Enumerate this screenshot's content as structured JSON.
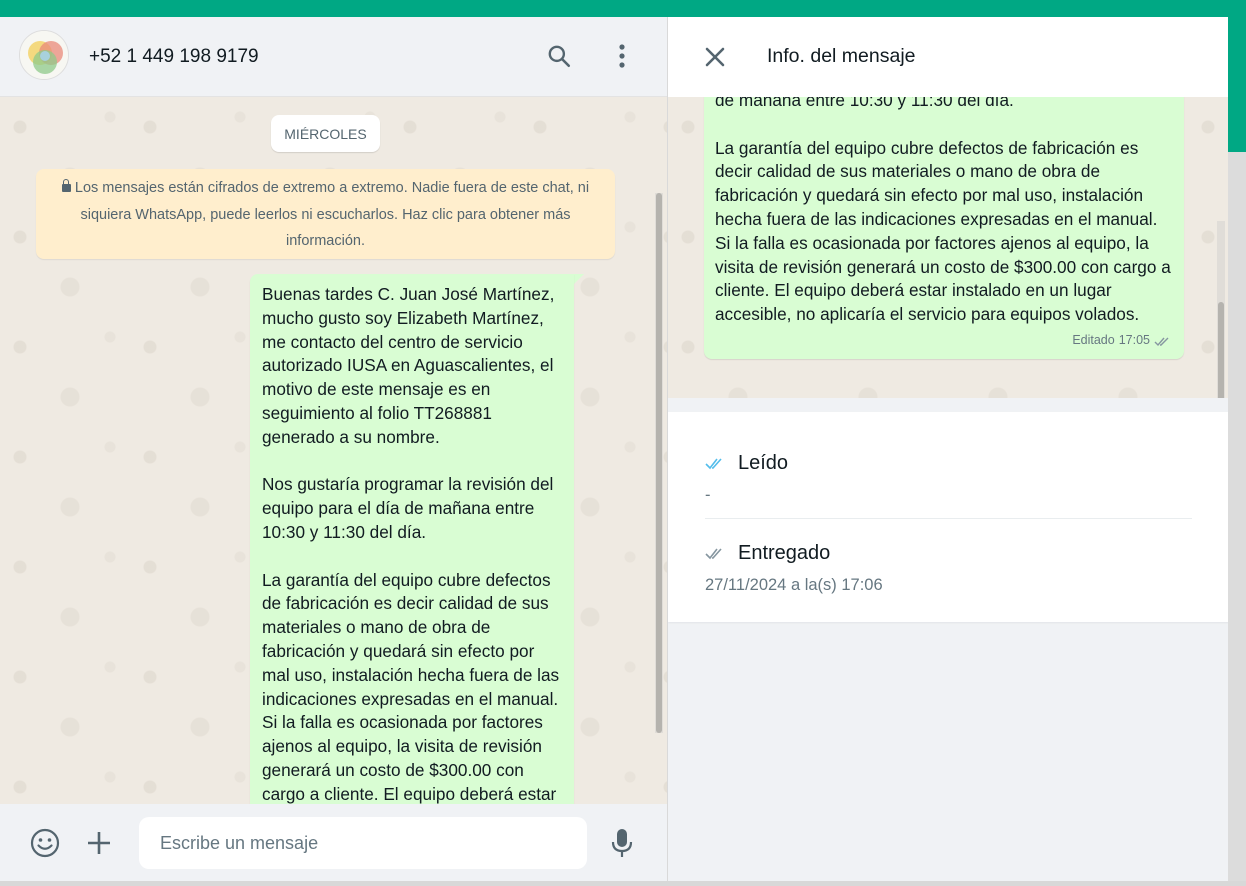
{
  "chat": {
    "contact_name": "+52 1 449 198 9179",
    "date_label": "MIÉRCOLES",
    "encryption_notice": "Los mensajes están cifrados de extremo a extremo. Nadie fuera de este chat, ni siquiera WhatsApp, puede leerlos ni escucharlos. Haz clic para obtener más información.",
    "message_text": "Buenas tardes C. Juan José Martínez, mucho gusto soy Elizabeth Martínez, me contacto del centro de servicio autorizado IUSA en Aguascalientes, el motivo de este mensaje es en seguimiento al folio TT268881 generado a su nombre.\n\nNos gustaría programar la revisión del equipo para el día de mañana entre 10:30 y 11:30 del día.\n\nLa garantía del equipo cubre defectos de fabricación es decir calidad de sus materiales o mano de obra de fabricación y quedará sin efecto por mal uso, instalación hecha fuera de las indicaciones expresadas en el manual. Si la falla es ocasionada por factores ajenos al equipo, la visita de revisión generará un costo de $300.00 con cargo a cliente. El equipo deberá estar"
  },
  "composer": {
    "placeholder": "Escribe un mensaje"
  },
  "info": {
    "title": "Info. del mensaje",
    "preview_text": "de mañana entre 10:30 y 11:30 del día.\n\nLa garantía del equipo cubre defectos de fabricación es decir calidad de sus materiales o mano de obra de fabricación y quedará sin efecto por mal uso, instalación hecha fuera de las indicaciones expresadas en el manual. Si la falla es ocasionada por factores ajenos al equipo, la visita de revisión generará un costo de $300.00 con cargo a cliente. El equipo deberá estar instalado en un lugar accesible, no aplicaría el servicio para equipos volados.",
    "edited_label": "Editado",
    "time": "17:05",
    "read_label": "Leído",
    "read_value": "-",
    "delivered_label": "Entregado",
    "delivered_value": "27/11/2024 a la(s) 17:06"
  },
  "colors": {
    "brand": "#00a884",
    "bubble_out": "#d9fdd3",
    "notice_bg": "#ffeecd",
    "read_check": "#53bdeb",
    "delivered_check": "#8696a0"
  },
  "icons": [
    "search-icon",
    "menu-icon",
    "close-icon",
    "emoji-icon",
    "plus-icon",
    "mic-icon",
    "lock-icon",
    "double-check-icon"
  ]
}
